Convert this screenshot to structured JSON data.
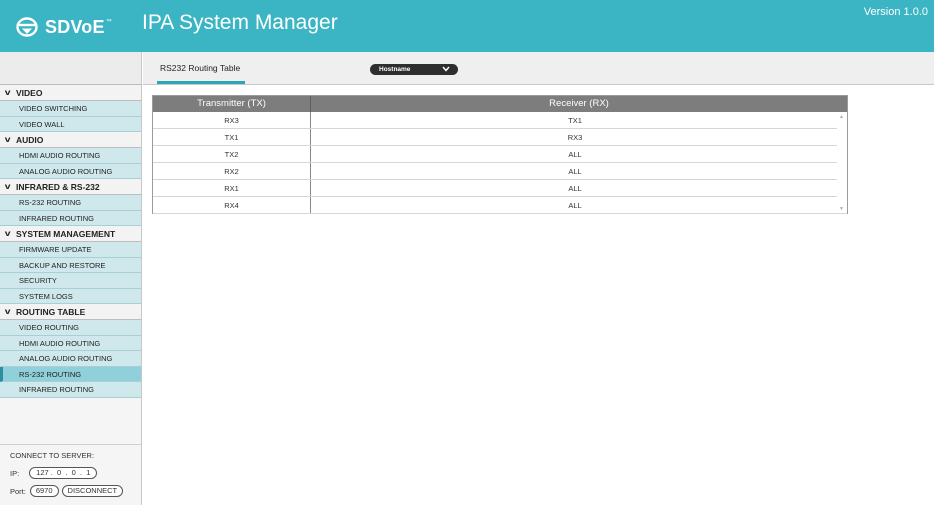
{
  "header": {
    "brand": "SDVoE",
    "brand_tm": "™",
    "title": "IPA System Manager",
    "version": "Version 1.0.0",
    "bg_color": "#3bb5c3"
  },
  "sidebar": {
    "sections": [
      {
        "label": "VIDEO",
        "items": [
          "VIDEO SWITCHING",
          "VIDEO WALL"
        ]
      },
      {
        "label": "AUDIO",
        "items": [
          "HDMI AUDIO ROUTING",
          "ANALOG AUDIO ROUTING"
        ]
      },
      {
        "label": "INFRARED & RS-232",
        "items": [
          "RS-232 ROUTING",
          "INFRARED ROUTING"
        ]
      },
      {
        "label": "SYSTEM MANAGEMENT",
        "items": [
          "FIRMWARE UPDATE",
          "BACKUP AND RESTORE",
          "SECURITY",
          "SYSTEM LOGS"
        ]
      },
      {
        "label": "ROUTING TABLE",
        "items": [
          "VIDEO ROUTING",
          "HDMI AUDIO ROUTING",
          "ANALOG AUDIO ROUTING",
          "RS-232 ROUTING",
          "INFRARED ROUTING"
        ]
      }
    ],
    "active_item": "RS-232 ROUTING (ROUTING TABLE)"
  },
  "connect": {
    "label": "CONNECT TO SERVER:",
    "ip_label": "IP:",
    "ip_value": "127 .  0  .  0  .  1",
    "port_label": "Port:",
    "port_value": "6970",
    "disconnect_label": "DISCONNECT"
  },
  "main": {
    "tab_label": "RS232 Routing Table",
    "dropdown_value": "Hostname",
    "table": {
      "headers": [
        "Transmitter (TX)",
        "Receiver (RX)"
      ],
      "rows": [
        [
          "RX3",
          "TX1"
        ],
        [
          "TX1",
          "RX3"
        ],
        [
          "TX2",
          "ALL"
        ],
        [
          "RX2",
          "ALL"
        ],
        [
          "RX1",
          "ALL"
        ],
        [
          "RX4",
          "ALL"
        ]
      ]
    }
  }
}
